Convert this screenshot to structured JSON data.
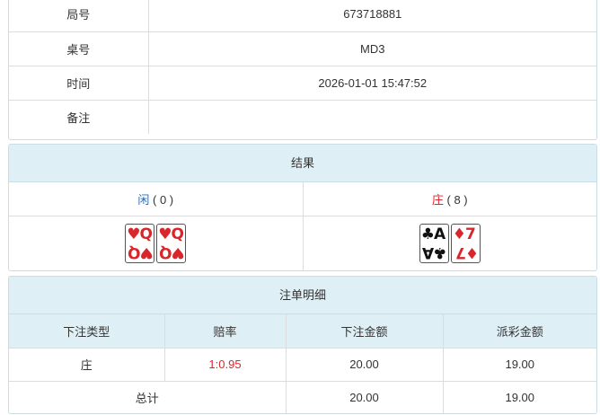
{
  "info": {
    "rows": [
      {
        "label": "局号",
        "value": "673718881"
      },
      {
        "label": "桌号",
        "value": "MD3"
      },
      {
        "label": "时间",
        "value": "2026-01-01 15:47:52"
      },
      {
        "label": "备注",
        "value": ""
      }
    ]
  },
  "result": {
    "title": "结果",
    "player": {
      "name": "闲",
      "score": "( 0 )",
      "cards": [
        {
          "rank": "Q",
          "suit": "♥"
        },
        {
          "rank": "Q",
          "suit": "♥"
        }
      ]
    },
    "banker": {
      "name": "庄",
      "score": "( 8 )",
      "cards": [
        {
          "rank": "A",
          "suit": "♣"
        },
        {
          "rank": "7",
          "suit": "♦"
        }
      ]
    }
  },
  "bets": {
    "title": "注单明细",
    "headers": [
      "下注类型",
      "赔率",
      "下注金额",
      "派彩金额"
    ],
    "rows": [
      {
        "type": "庄",
        "odds": "1:0.95",
        "amount": "20.00",
        "payout": "19.00"
      }
    ],
    "total": {
      "label": "总计",
      "amount": "20.00",
      "payout": "19.00"
    }
  },
  "colors": {
    "panel_header_bg": "#dfeff6",
    "player": "#2a6fb8",
    "banker": "#d9262b"
  }
}
